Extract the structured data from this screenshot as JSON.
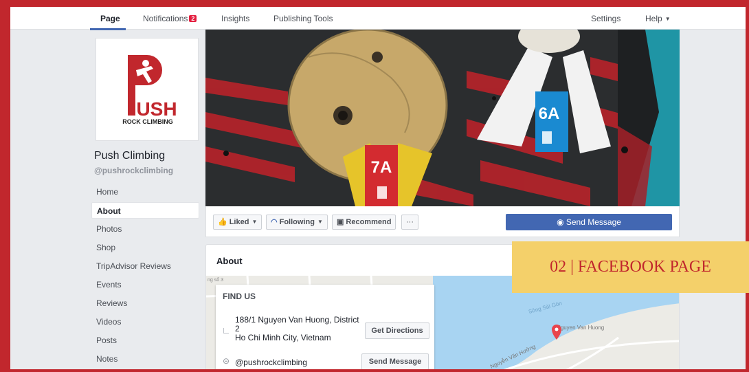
{
  "nav": {
    "tabs": [
      {
        "label": "Page"
      },
      {
        "label": "Notifications",
        "badge": "2"
      },
      {
        "label": "Insights"
      },
      {
        "label": "Publishing Tools"
      }
    ],
    "settings": "Settings",
    "help": "Help"
  },
  "profile": {
    "logo_text": "USH",
    "logo_sub": "ROCK CLIMBING",
    "name": "Push Climbing",
    "handle": "@pushrockclimbing"
  },
  "sidebar": {
    "items": [
      {
        "label": "Home"
      },
      {
        "label": "About"
      },
      {
        "label": "Photos"
      },
      {
        "label": "Shop"
      },
      {
        "label": "TripAdvisor Reviews"
      },
      {
        "label": "Events"
      },
      {
        "label": "Reviews"
      },
      {
        "label": "Videos"
      },
      {
        "label": "Posts"
      },
      {
        "label": "Notes"
      }
    ],
    "active": "About"
  },
  "cover": {
    "tag_left": "7A",
    "tag_right": "6A"
  },
  "actions": {
    "liked": "Liked",
    "following": "Following",
    "recommend": "Recommend",
    "more": "···",
    "send_message": "Send Message"
  },
  "about": {
    "title": "About",
    "find_us": "FIND US",
    "address_line1": "188/1 Nguyen Van Huong, District 2",
    "address_line2": "Ho Chi Minh City, Vietnam",
    "get_directions": "Get Directions",
    "messenger_handle": "@pushrockclimbing",
    "send_message": "Send Message",
    "map_labels": [
      "Sông Sài Gòn",
      "Nguyễn Văn Hưởng",
      "Nguyen Van Huong",
      "ng số 3"
    ]
  },
  "section_label": "02 | FACEBOOK PAGE",
  "colors": {
    "brand_red": "#c1272d",
    "facebook_blue": "#4267b2",
    "label_yellow": "#f4d06a"
  }
}
